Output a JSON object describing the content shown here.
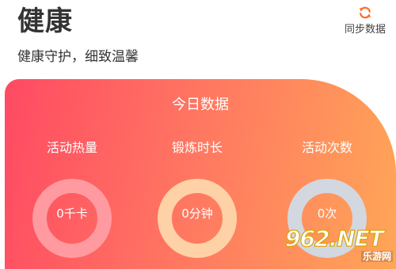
{
  "header": {
    "title": "健康",
    "subtitle": "健康守护，细致温馨",
    "sync": {
      "label": "同步数据",
      "icon": "sync-icon",
      "color": "#ff6a2c"
    }
  },
  "today_card": {
    "title": "今日数据",
    "gradient": [
      "#ff4a63",
      "#ffa657"
    ],
    "metrics": [
      {
        "label": "活动热量",
        "value": "0千卡",
        "progress": 0,
        "ring_color": "#ff9aa0"
      },
      {
        "label": "锻炼时长",
        "value": "0分钟",
        "progress": 0,
        "ring_color": "#ffd1a6"
      },
      {
        "label": "活动次数",
        "value": "0次",
        "progress": 0,
        "ring_color": "#d3d7e0"
      }
    ]
  },
  "watermark": {
    "logo": "962.NET",
    "sub": "乐游网"
  }
}
